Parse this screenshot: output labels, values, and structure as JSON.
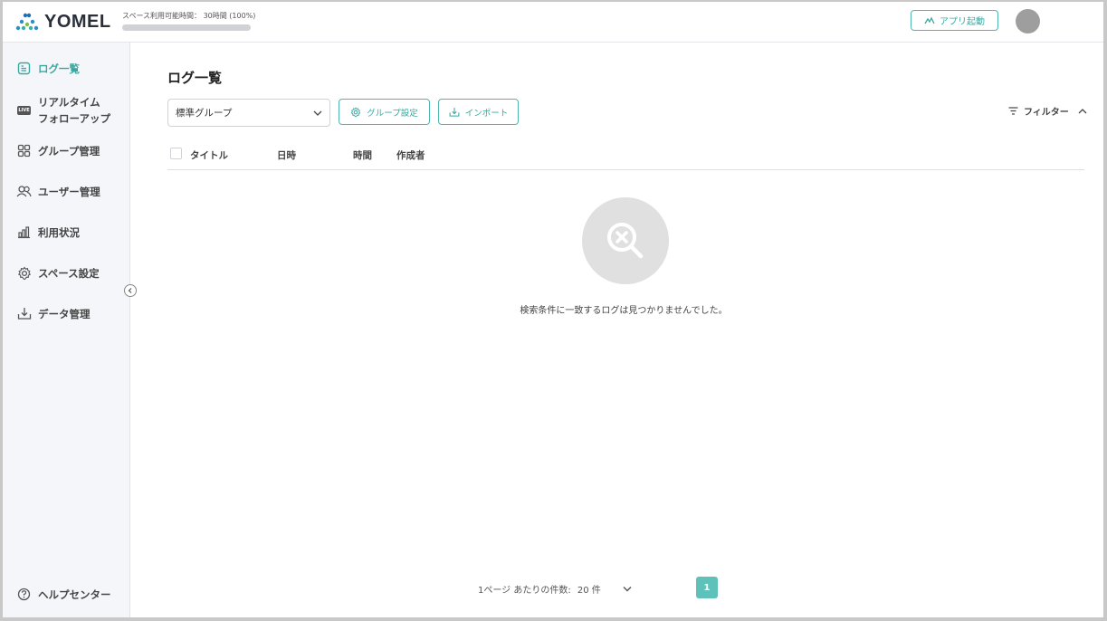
{
  "header": {
    "logo_text": "YOMEL",
    "usage_text": "スペース利用可能時間： 30時間 (100%)",
    "usage_percent": 100,
    "app_button_label": "アプリ起動"
  },
  "sidebar": {
    "items": [
      {
        "label": "ログ一覧",
        "icon": "document-list-icon",
        "active": true
      },
      {
        "label_line1": "リアルタイム",
        "label_line2": "フォローアップ",
        "icon": "live-icon",
        "live_text": "LIVE"
      },
      {
        "label": "グループ管理",
        "icon": "grid-icon"
      },
      {
        "label": "ユーザー管理",
        "icon": "users-icon"
      },
      {
        "label": "利用状況",
        "icon": "bar-chart-icon"
      },
      {
        "label": "スペース設定",
        "icon": "gear-icon"
      },
      {
        "label": "データ管理",
        "icon": "download-tray-icon"
      }
    ],
    "help_label": "ヘルプセンター"
  },
  "main": {
    "title": "ログ一覧",
    "group_select_value": "標準グループ",
    "group_settings_label": "グループ設定",
    "import_label": "インポート",
    "filter_label": "フィルター",
    "columns": [
      "タイトル",
      "日時",
      "時間",
      "作成者"
    ],
    "empty_message": "検索条件に一致するログは見つかりませんでした。",
    "pagination": {
      "per_page_label": "1ページ あたりの件数:",
      "per_page_value": "20 件",
      "current_page": "1"
    }
  },
  "colors": {
    "accent": "#3aa7a1",
    "page_active": "#5ec2bb",
    "sidebar_bg": "#f5f6fa"
  }
}
